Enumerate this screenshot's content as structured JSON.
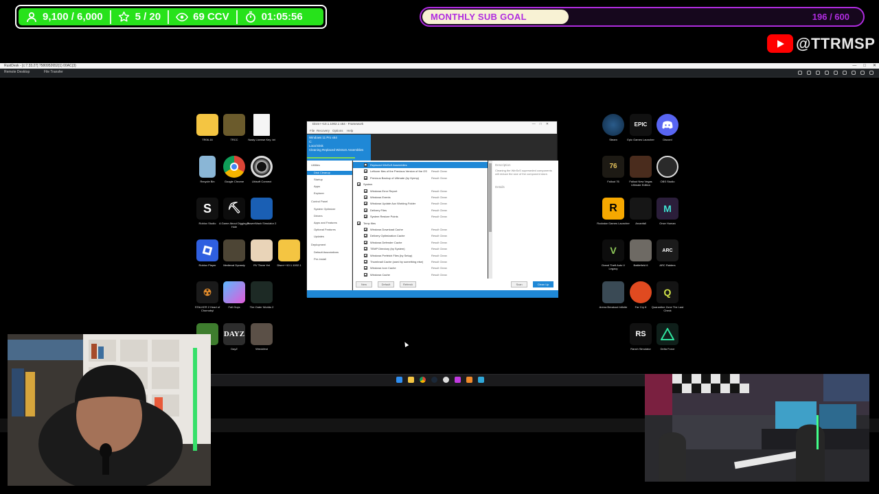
{
  "overlay": {
    "stats": {
      "followers": "9,100 / 6,000",
      "stars": "5 / 20",
      "viewers": "69 CCV",
      "timer": "01:05:56"
    },
    "sub_goal": {
      "label": "MONTHLY SUB GOAL",
      "count": "196 / 600",
      "progress": 0.33,
      "color": "#b02ce0"
    },
    "youtube_handle": "@TTRMSP"
  },
  "remote": {
    "title": "RustDesk - [c:7.33.27] 7580952652(1) 00AC(3)",
    "tabs": [
      "Remote Desktop",
      "File Transfer"
    ]
  },
  "desktop": {
    "icons_left": [
      {
        "label": "TR06-16",
        "icon": "folder-icon"
      },
      {
        "label": "TRCC",
        "icon": "app-icon"
      },
      {
        "label": "Nasty License Key .txt",
        "icon": "file-icon"
      },
      {
        "label": "Recycle Bin",
        "icon": "recycle-bin-icon"
      },
      {
        "label": "Google Chrome",
        "icon": "chrome-icon"
      },
      {
        "label": "Ubisoft Connect",
        "icon": "ubisoft-icon"
      },
      {
        "label": "Roblox Studio",
        "icon": "roblox-studio-icon"
      },
      {
        "label": "A Game About Digging A Hole",
        "icon": "game-icon"
      },
      {
        "label": "PowerWash Simulator 2",
        "icon": "game-icon"
      },
      {
        "label": "Roblox Player",
        "icon": "roblox-icon"
      },
      {
        "label": "Medieval Dynasty",
        "icon": "game-icon"
      },
      {
        "label": "RV There Yet",
        "icon": "game-icon"
      },
      {
        "label": "Dism++10.1.1002.1",
        "icon": "folder-icon"
      },
      {
        "label": "STALKER 2 Heart of Chornobyl",
        "icon": "game-icon"
      },
      {
        "label": "Fall Guys",
        "icon": "game-icon"
      },
      {
        "label": "The Outer Worlds 2",
        "icon": "game-icon"
      },
      {
        "label": "...k",
        "icon": "game-icon"
      },
      {
        "label": "DayZ",
        "icon": "game-icon"
      },
      {
        "label": "Wreckfest",
        "icon": "game-icon"
      }
    ],
    "icons_right": [
      {
        "label": "Steam",
        "icon": "steam-icon"
      },
      {
        "label": "Epic Games Launcher",
        "icon": "epic-icon"
      },
      {
        "label": "Discord",
        "icon": "discord-icon"
      },
      {
        "label": "Fallout 76",
        "icon": "game-icon"
      },
      {
        "label": "Fallout New Vegas Ultimate Edition",
        "icon": "game-icon"
      },
      {
        "label": "OBS Studio",
        "icon": "obs-icon"
      },
      {
        "label": "Rockstar Games Launcher",
        "icon": "rockstar-icon"
      },
      {
        "label": "Arcanfall",
        "icon": "game-icon"
      },
      {
        "label": "Once Human",
        "icon": "game-icon"
      },
      {
        "label": "Grand Theft Auto V Legacy",
        "icon": "game-icon"
      },
      {
        "label": "Battlefield 6",
        "icon": "game-icon"
      },
      {
        "label": "ARC Raiders",
        "icon": "game-icon"
      },
      {
        "label": "Arena Breakout Infinite",
        "icon": "game-icon"
      },
      {
        "label": "Far Cry 6",
        "icon": "game-icon"
      },
      {
        "label": "Quarantine Zone The Last Check",
        "icon": "game-icon"
      },
      {
        "label": "Ranch Simulator",
        "icon": "game-icon"
      },
      {
        "label": "Delta Force",
        "icon": "game-icon"
      }
    ]
  },
  "cleanup_window": {
    "title": "Dism++10.1.1002.1 x64 - Framework",
    "menu": [
      "File",
      "Recovery",
      "Options",
      "Help"
    ],
    "header": [
      "Windows 11 Pro x64",
      "C:",
      "Local Disk",
      "Cleaning Replaced WinSxS Assemblies"
    ],
    "nav": [
      "Utilities",
      "Disk Cleanup",
      "Startup",
      "Apps",
      "Explorer",
      "Control Panel",
      "System Optimizer",
      "Drivers",
      "Apps and Features",
      "Optional Features",
      "Updates",
      "Deployment",
      "Default Associations",
      "Pre-Install"
    ],
    "rows": [
      {
        "label": "Replaced WinSxS Assemblies",
        "status": "",
        "selected": true,
        "indent": 1
      },
      {
        "label": "Leftover files of the Previous Version of the OS",
        "status": "Result Clean",
        "selected": false,
        "indent": 1
      },
      {
        "label": "Previous Backup of Ultimate (by Hyrmp)",
        "status": "Result Clean",
        "selected": false,
        "indent": 1
      },
      {
        "label": "System",
        "status": "",
        "selected": false,
        "indent": 0
      },
      {
        "label": "Windows Error Report",
        "status": "Result Clean",
        "selected": false,
        "indent": 1
      },
      {
        "label": "Windows Events",
        "status": "Result Clean",
        "selected": false,
        "indent": 1
      },
      {
        "label": "Windows Update Aux Working Folder",
        "status": "Result Clean",
        "selected": false,
        "indent": 1
      },
      {
        "label": "Delivery Files",
        "status": "Result Clean",
        "selected": false,
        "indent": 1
      },
      {
        "label": "System Restore Points",
        "status": "Result Clean",
        "selected": false,
        "indent": 1
      },
      {
        "label": "Temp files",
        "status": "",
        "selected": false,
        "indent": 0
      },
      {
        "label": "Windows Download Cache",
        "status": "Result Clean",
        "selected": false,
        "indent": 1
      },
      {
        "label": "Delivery Optimization Cache",
        "status": "Result Clean",
        "selected": false,
        "indent": 1
      },
      {
        "label": "Windows Defender Cache",
        "status": "Result Clean",
        "selected": false,
        "indent": 1
      },
      {
        "label": "TEMP Directory (by System)",
        "status": "Result Clean",
        "selected": false,
        "indent": 1
      },
      {
        "label": "Windows Prefetch Files (by Setup)",
        "status": "Result Clean",
        "selected": false,
        "indent": 1
      },
      {
        "label": "Thumbnail Cache (used by something else)",
        "status": "Result Clean",
        "selected": false,
        "indent": 1
      },
      {
        "label": "Windows Icon Cache",
        "status": "Result Clean",
        "selected": false,
        "indent": 1
      },
      {
        "label": "Windows Cache",
        "status": "Result Clean",
        "selected": false,
        "indent": 1
      }
    ],
    "description_heading": "Description",
    "description_text": "Cleaning the WinSxS superseded components will reduce the size of the component store.",
    "details_heading": "Details",
    "buttons": {
      "new": "New",
      "default": "Default",
      "refresh": "Refresh",
      "scan": "Scan",
      "clean": "Clean Up"
    }
  }
}
